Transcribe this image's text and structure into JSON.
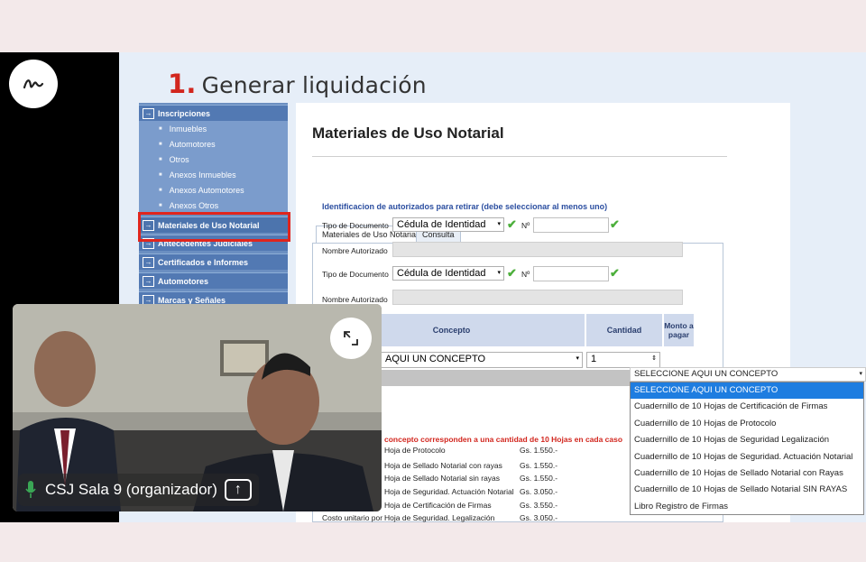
{
  "slide": {
    "number": "1.",
    "title": "Generar liquidación"
  },
  "sidebar": {
    "items": [
      {
        "label": "Inscripciones",
        "type": "main"
      },
      {
        "label": "Inmuebles",
        "type": "sub"
      },
      {
        "label": "Automotores",
        "type": "sub"
      },
      {
        "label": "Otros",
        "type": "sub"
      },
      {
        "label": "Anexos Inmuebles",
        "type": "sub"
      },
      {
        "label": "Anexos Automotores",
        "type": "sub"
      },
      {
        "label": "Anexos Otros",
        "type": "sub"
      },
      {
        "label": "Materiales de Uso Notarial",
        "type": "main"
      },
      {
        "label": "Antecedentes Judiciales",
        "type": "main"
      },
      {
        "label": "Certificados e Informes",
        "type": "main"
      },
      {
        "label": "Automotores",
        "type": "main"
      },
      {
        "label": "Marcas y Señales",
        "type": "main"
      }
    ]
  },
  "panel": {
    "title": "Materiales de Uso Notarial",
    "tabs": [
      "Materiales de Uso Notarial",
      "Consulta"
    ],
    "ident_label": "Identificacion de autorizados para retirar (debe seleccionar al menos uno)",
    "doc_type_label": "Tipo de Documento",
    "doc_type_value": "Cédula de Identidad",
    "number_label": "Nº",
    "name_label": "Nombre Autorizado",
    "table": {
      "headers": [
        "Concepto",
        "Cantidad",
        "Monto a pagar"
      ],
      "concepto_value": "AQUI UN CONCEPTO",
      "cantidad_value": "1"
    },
    "note": "concepto corresponden a una cantidad de 10 Hojas en cada caso",
    "costs": [
      {
        "item": "Hoja de Protocolo",
        "price": "Gs. 1.550.-"
      },
      {
        "item": "Hoja de Sellado Notarial con rayas",
        "price": "Gs. 1.550.-"
      },
      {
        "item": "Hoja de Sellado Notarial sin rayas",
        "price": "Gs. 1.550.-"
      },
      {
        "item": "Hoja de Seguridad. Actuación Notarial",
        "price": "Gs. 3.050.-"
      },
      {
        "item": "Hoja de Certificación de Firmas",
        "price": "Gs. 3.550.-"
      },
      {
        "item": "Hoja de Seguridad. Legalización",
        "price": "Gs. 3.050.-"
      }
    ],
    "cost_prefix": "Costo unitario por"
  },
  "dropdown": {
    "header": "SELECCIONE AQUI UN CONCEPTO",
    "options": [
      "SELECCIONE AQUI UN CONCEPTO",
      "Cuadernillo de 10 Hojas de Certificación de Firmas",
      "Cuadernillo de 10 Hojas de Protocolo",
      "Cuadernillo de 10 Hojas de Seguridad Legalización",
      "Cuadernillo de 10 Hojas de Seguridad. Actuación Notarial",
      "Cuadernillo de 10 Hojas de Sellado Notarial con Rayas",
      "Cuadernillo de 10 Hojas de Sellado Notarial SIN RAYAS",
      "Libro Registro de Firmas"
    ],
    "selected_index": 0
  },
  "video": {
    "participant_label": "CSJ Sala 9 (organizador)"
  },
  "colors": {
    "accent_red": "#e0251d",
    "sidebar_blue": "#5279b3",
    "dropdown_selected": "#1e7de0",
    "check_green": "#4caf3b"
  }
}
